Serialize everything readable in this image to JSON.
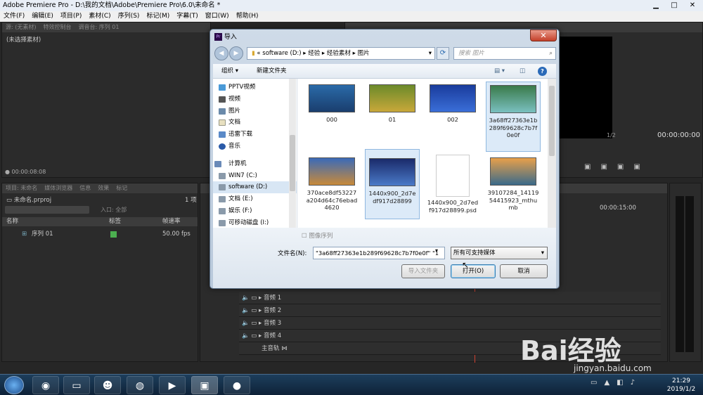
{
  "app": {
    "window_title": "Adobe Premiere Pro - D:\\我的文档\\Adobe\\Premiere Pro\\6.0\\未命名 *",
    "menu": [
      "文件(F)",
      "编辑(E)",
      "项目(P)",
      "素材(C)",
      "序列(S)",
      "标记(M)",
      "字幕(T)",
      "窗口(W)",
      "帮助(H)"
    ]
  },
  "workspace": {
    "source_tabs": [
      "源: (无素材)",
      "特效控制台",
      "调音台: 序列 01",
      "元数据"
    ],
    "source_empty": "(未选择素材)",
    "source_timecode": "00:00:08:08",
    "program_timecode": "00:00:00:00",
    "program_zoom": "1/2",
    "project_tabs": [
      "项目: 未命名",
      "媒体浏览器",
      "信息",
      "效果",
      "标记",
      "历"
    ],
    "project_file": "未命名.prproj",
    "item_count": "1 项",
    "entry_label": "入口:",
    "entry_value": "全部",
    "columns": [
      "名称",
      "标签",
      "帧速率"
    ],
    "items": [
      {
        "name": "序列 01",
        "fps": "50.00 fps",
        "color": "#4caf50"
      }
    ],
    "timeline_timecode": "00:00:15:00",
    "audio_tracks": [
      "音频 1",
      "音频 2",
      "音频 3",
      "音频 4",
      "主音轨"
    ]
  },
  "dialog": {
    "title": "导入",
    "close_glyph": "✕",
    "address": [
      "software (D:)",
      "经验",
      "经验素材",
      "图片"
    ],
    "address_prefix": "«",
    "search_placeholder": "搜索 图片",
    "organize": "组织 ▾",
    "new_folder": "新建文件夹",
    "nav_items": [
      "PPTV视频",
      "视频",
      "图片",
      "文档",
      "迅雷下载",
      "音乐",
      "计算机",
      "WIN7 (C:)",
      "software (D:)",
      "文档 (E:)",
      "娱乐 (F:)",
      "可移动磁盘 (I:)"
    ],
    "files": [
      {
        "name": "000",
        "thumb": "linear-gradient(#2a6aa8,#1a3e6e)"
      },
      {
        "name": "01",
        "thumb": "linear-gradient(#6b8a2a,#c9a83a)"
      },
      {
        "name": "002",
        "thumb": "linear-gradient(#1a3c9c,#3a6ed8)"
      },
      {
        "name": "3a68ff27363e1b289f69628c7b7f0e0f",
        "thumb": "linear-gradient(#3a7a4a,#7ac0c0)"
      },
      {
        "name": "370ace8df53227a204d64c76ebad4620",
        "thumb": "linear-gradient(#3a6ab8,#c88a3a)"
      },
      {
        "name": "1440x900_2d7edf917d28899",
        "thumb": "linear-gradient(#1a2a6a,#4a7ac8)"
      },
      {
        "name": "1440x900_2d7edf917d28899.psd",
        "thumb": "#ffffff"
      },
      {
        "name": "39107284_1411954415923_mthumb",
        "thumb": "linear-gradient(#e8a04a,#3a6a8a)"
      }
    ],
    "sequence_checkbox": "图像序列",
    "filename_label": "文件名(N):",
    "filename_value": "\"3a68ff27363e1b289f69628c7b7f0e0f\" \"1",
    "filetype": "所有可支持媒体",
    "import_folder": "导入文件夹",
    "open": "打开(O)",
    "cancel": "取消"
  },
  "taskbar": {
    "time": "21:29",
    "date": "2019/1/2"
  },
  "watermark": {
    "brand": "Bai经验",
    "url": "jingyan.baidu.com"
  }
}
